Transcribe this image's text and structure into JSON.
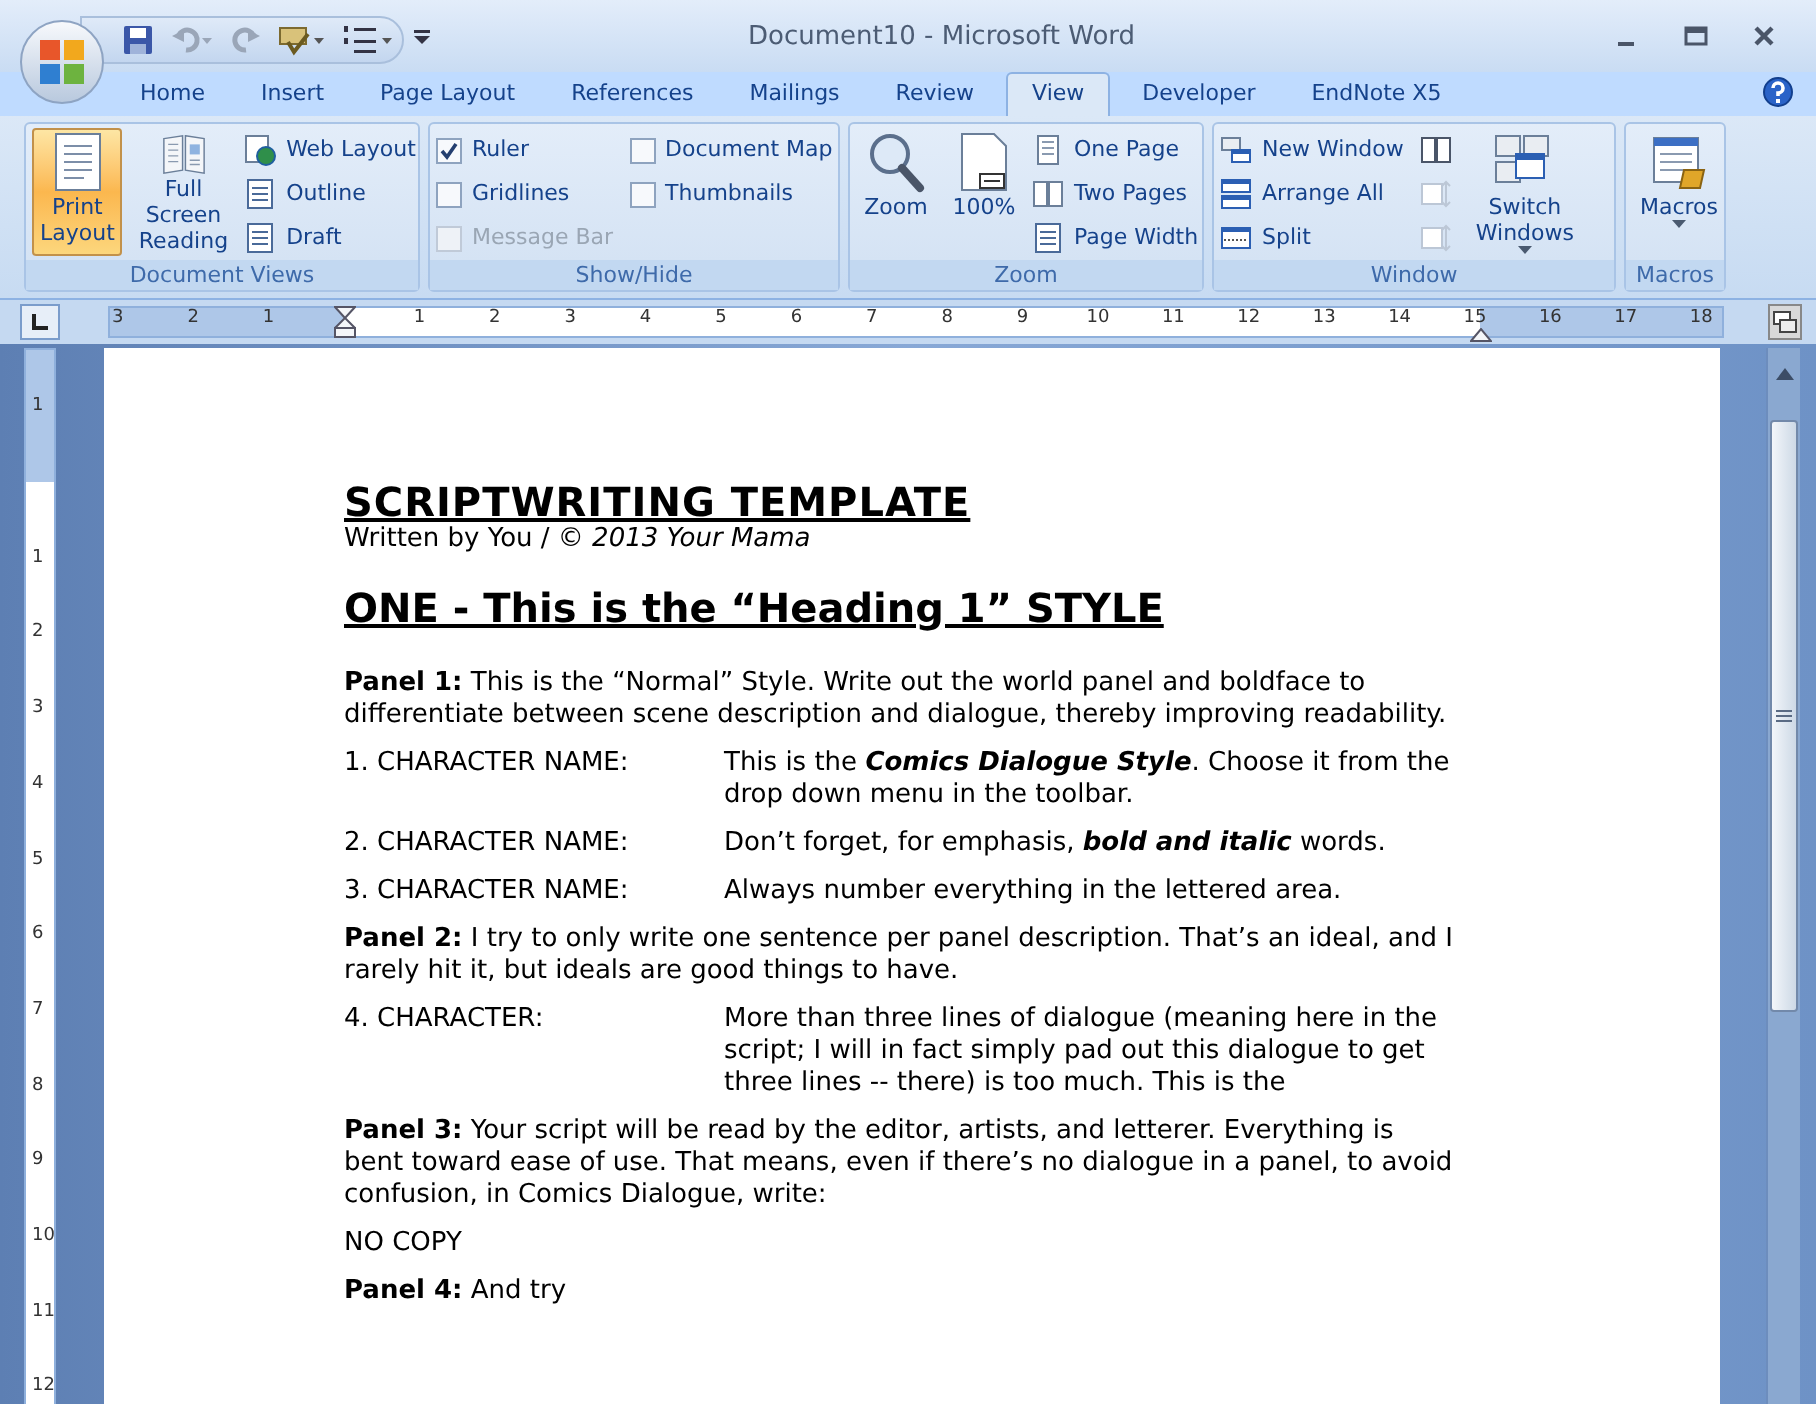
{
  "window": {
    "title": "Document10 - Microsoft Word"
  },
  "tabs": [
    {
      "label": "Home",
      "selected": false
    },
    {
      "label": "Insert",
      "selected": false
    },
    {
      "label": "Page Layout",
      "selected": false
    },
    {
      "label": "References",
      "selected": false
    },
    {
      "label": "Mailings",
      "selected": false
    },
    {
      "label": "Review",
      "selected": false
    },
    {
      "label": "View",
      "selected": true
    },
    {
      "label": "Developer",
      "selected": false
    },
    {
      "label": "EndNote X5",
      "selected": false
    }
  ],
  "ribbon": [
    {
      "label": "Document Views",
      "items": [
        {
          "kind": "large",
          "label": "Print\nLayout",
          "selected": true
        },
        {
          "kind": "large",
          "label": "Full Screen\nReading",
          "selected": false
        },
        {
          "kind": "stack",
          "items": [
            {
              "kind": "small",
              "label": "Web Layout"
            },
            {
              "kind": "small",
              "label": "Outline"
            },
            {
              "kind": "small",
              "label": "Draft"
            }
          ]
        }
      ]
    },
    {
      "label": "Show/Hide",
      "items": [
        {
          "kind": "stack",
          "items": [
            {
              "kind": "checkbox",
              "label": "Ruler",
              "checked": true,
              "disabled": false
            },
            {
              "kind": "checkbox",
              "label": "Gridlines",
              "checked": false,
              "disabled": false
            },
            {
              "kind": "checkbox",
              "label": "Message Bar",
              "checked": false,
              "disabled": true
            }
          ]
        },
        {
          "kind": "stack",
          "items": [
            {
              "kind": "checkbox",
              "label": "Document Map",
              "checked": false,
              "disabled": false
            },
            {
              "kind": "checkbox",
              "label": "Thumbnails",
              "checked": false,
              "disabled": false
            }
          ]
        }
      ]
    },
    {
      "label": "Zoom",
      "items": [
        {
          "kind": "large",
          "label": "Zoom",
          "selected": false
        },
        {
          "kind": "large",
          "label": "100%",
          "selected": false
        },
        {
          "kind": "stack",
          "items": [
            {
              "kind": "small",
              "label": "One Page"
            },
            {
              "kind": "small",
              "label": "Two Pages"
            },
            {
              "kind": "small",
              "label": "Page Width"
            }
          ]
        }
      ]
    },
    {
      "label": "Window",
      "items": [
        {
          "kind": "stack",
          "items": [
            {
              "kind": "small",
              "label": "New Window"
            },
            {
              "kind": "small",
              "label": "Arrange All"
            },
            {
              "kind": "small",
              "label": "Split"
            }
          ]
        },
        {
          "kind": "stack",
          "items": [
            {
              "kind": "icon",
              "disabled": false
            },
            {
              "kind": "icon",
              "disabled": true
            },
            {
              "kind": "icon",
              "disabled": true
            }
          ]
        },
        {
          "kind": "large",
          "label": "Switch\nWindows",
          "selected": false,
          "dropdown": true
        }
      ]
    },
    {
      "label": "Macros",
      "items": [
        {
          "kind": "large",
          "label": "Macros",
          "selected": false,
          "dropdown": true
        }
      ]
    }
  ],
  "ruler": {
    "left_labels": [
      "3",
      "2",
      "1"
    ],
    "right_labels": [
      "1",
      "2",
      "3",
      "4",
      "5",
      "6",
      "7",
      "8",
      "9",
      "10",
      "11",
      "12",
      "13",
      "14",
      "15",
      "16",
      "17",
      "18"
    ],
    "vertical_top_labels": [
      "1"
    ],
    "vertical_labels": [
      "1",
      "2",
      "3",
      "4",
      "5",
      "6",
      "7",
      "8",
      "9",
      "10",
      "11",
      "12"
    ]
  },
  "document": [
    {
      "kind": "title",
      "text": "SCRIPTWRITING TEMPLATE"
    },
    {
      "kind": "byline",
      "text": "Written by You / *© 2013 Your Mama*"
    },
    {
      "kind": "heading",
      "text": "ONE - This is the “Heading 1” STYLE"
    },
    {
      "kind": "body",
      "text": "**Panel 1:** This is the “Normal” Style. Write out the world panel and boldface to differentiate between scene description and dialogue, thereby improving readability."
    },
    {
      "kind": "dialogue",
      "character": "1. CHARACTER NAME:",
      "text": "This is the **Comics Dialogue Style**. Choose it from the drop down menu in the toolbar."
    },
    {
      "kind": "dialogue",
      "character": "2. CHARACTER NAME:",
      "text": "Don’t forget, for emphasis, **bold and italic** words."
    },
    {
      "kind": "dialogue",
      "character": "3. CHARACTER NAME:",
      "text": "Always number everything in the lettered area."
    },
    {
      "kind": "body",
      "text": "**Panel 2:** I try to only write one sentence per panel description. That’s an ideal, and I rarely hit it, but ideals are good things to have."
    },
    {
      "kind": "dialogue",
      "character": "4. CHARACTER:",
      "text": "More than three lines of dialogue (meaning here in the script; I will in fact simply pad out this dialogue to get three lines -- there) is too much. This is the"
    },
    {
      "kind": "body",
      "text": "**Panel 3:** Your script will be read by the editor, artists, and letterer. Everything is bent toward ease of use. That means, even if there’s no dialogue in a panel, to avoid confusion, in Comics Dialogue, write:"
    },
    {
      "kind": "body",
      "text": "NO COPY"
    },
    {
      "kind": "body",
      "text": "**Panel 4:** And try"
    }
  ]
}
